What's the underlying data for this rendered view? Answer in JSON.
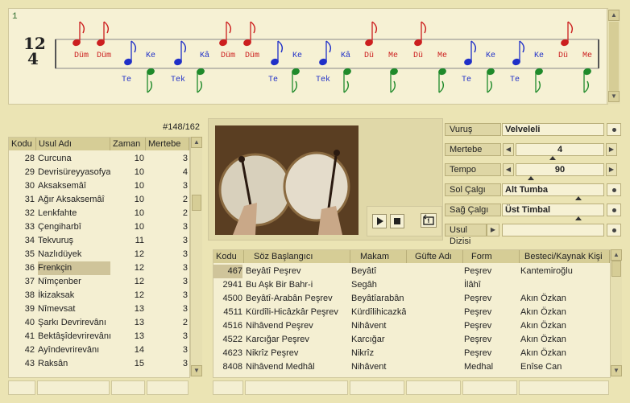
{
  "score": {
    "measure_number": "1",
    "time_sig_top": "12",
    "time_sig_bottom": "4",
    "upper_syllables": [
      "Düm",
      "Düm",
      "Ke",
      "Kâ",
      "Düm",
      "Düm",
      "Ke",
      "Kâ",
      "Dü",
      "Me",
      "Dü",
      "Me",
      "Ke",
      "Ke",
      "Dü",
      "Me"
    ],
    "lower_syllables": [
      "Te",
      "Tek",
      "Te",
      "Tek",
      "Te",
      "Te"
    ]
  },
  "left": {
    "counter": "#148/162",
    "columns": [
      "Kodu",
      "Usul Adı",
      "Zaman",
      "Mertebe"
    ],
    "rows": [
      [
        "28",
        "Curcuna",
        "10",
        "3"
      ],
      [
        "29",
        "Devrisüreyyasofya",
        "10",
        "4"
      ],
      [
        "30",
        "Aksaksemâî",
        "10",
        "3"
      ],
      [
        "31",
        "Ağır Aksaksemâî",
        "10",
        "2"
      ],
      [
        "32",
        "Lenkfahte",
        "10",
        "2"
      ],
      [
        "33",
        "Çengiharbî",
        "10",
        "3"
      ],
      [
        "34",
        "Tekvuruş",
        "11",
        "3"
      ],
      [
        "35",
        "Nazlıdüyek",
        "12",
        "3"
      ],
      [
        "36",
        "Frenkçin",
        "12",
        "3"
      ],
      [
        "37",
        "Nîmçenber",
        "12",
        "3"
      ],
      [
        "38",
        "İkizaksak",
        "12",
        "3"
      ],
      [
        "39",
        "Nîmevsat",
        "13",
        "3"
      ],
      [
        "40",
        "Şarkı Devrirevânı",
        "13",
        "2"
      ],
      [
        "41",
        "Bektâşîdevrirevânı",
        "13",
        "3"
      ],
      [
        "42",
        "Ayîndevrirevânı",
        "14",
        "3"
      ],
      [
        "43",
        "Raksân",
        "15",
        "3"
      ]
    ],
    "selected_index": 8
  },
  "controls": {
    "vurus_label": "Vuruş",
    "vurus_value": "Velveleli",
    "mertebe_label": "Mertebe",
    "mertebe_value": "4",
    "tempo_label": "Tempo",
    "tempo_value": "90",
    "sol_label": "Sol Çalgı",
    "sol_value": "Alt Tumba",
    "sag_label": "Sağ Çalgı",
    "sag_value": "Üst Timbal",
    "dizi_label": "Usul Dizisi",
    "dizi_value": ""
  },
  "bottom": {
    "columns": [
      "Kodu",
      "Söz Başlangıcı",
      "Makam",
      "Güfte Adı",
      "Form",
      "Besteci/Kaynak Kişi"
    ],
    "rows": [
      [
        "467",
        "Beyâtî Peşrev",
        "Beyâtî",
        "",
        "Peşrev",
        "Kantemiroğlu"
      ],
      [
        "2941",
        "Bu Aşk Bir Bahr-i",
        "Segâh",
        "",
        "İlâhî",
        ""
      ],
      [
        "4500",
        "Beyâtî-Arabân Peşrev",
        "Beyâtîarabân",
        "",
        "Peşrev",
        "Akın Özkan"
      ],
      [
        "4511",
        "Kürdîli-Hicâzkâr Peşrev",
        "Kürdîlihicazkâr",
        "",
        "Peşrev",
        "Akın Özkan"
      ],
      [
        "4516",
        "Nihâvend Peşrev",
        "Nihâvent",
        "",
        "Peşrev",
        "Akın Özkan"
      ],
      [
        "4522",
        "Karcığar Peşrev",
        "Karcığar",
        "",
        "Peşrev",
        "Akın Özkan"
      ],
      [
        "4623",
        "Nikrîz Peşrev",
        "Nikrîz",
        "",
        "Peşrev",
        "Akın Özkan"
      ],
      [
        "8408",
        "Nihâvend Medhâl",
        "Nihâvent",
        "",
        "Medhal",
        "Enîse Can"
      ]
    ]
  },
  "colors": {
    "upper": "#cc1f1f",
    "mid": "#1f2fc8",
    "lower": "#1f8a2a",
    "bg": "#ebe4b4"
  }
}
